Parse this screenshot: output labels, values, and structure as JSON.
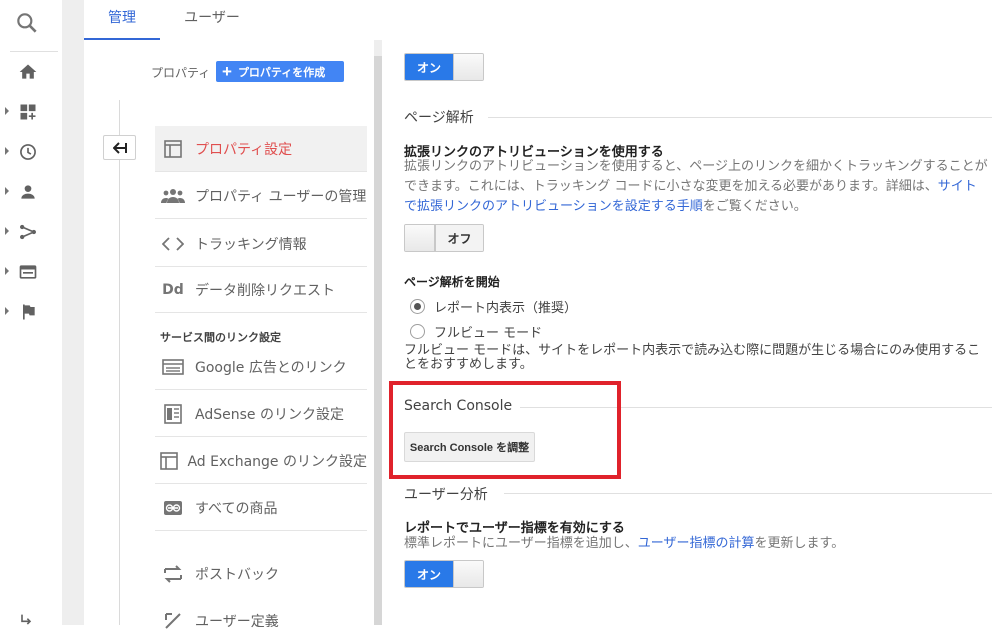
{
  "tabs": [
    {
      "label": "管理",
      "active": true
    },
    {
      "label": "ユーザー",
      "active": false
    }
  ],
  "leftnav": {
    "icons": [
      "search-icon",
      "home-icon",
      "customization-icon",
      "clock-icon",
      "person-icon",
      "acquisition-icon",
      "behavior-icon",
      "flag-icon"
    ]
  },
  "property_column": {
    "label": "プロパティ",
    "create_button": "プロパティを作成",
    "items": [
      {
        "label": "プロパティ設定",
        "icon": "property-settings-icon",
        "active": true
      },
      {
        "label": "プロパティ ユーザーの管理",
        "icon": "users-group-icon"
      },
      {
        "label": "トラッキング情報",
        "icon": "code-icon"
      },
      {
        "label": "データ削除リクエスト",
        "icon": "dd-icon"
      }
    ],
    "section_label": "サービス間のリンク設定",
    "link_items": [
      {
        "label": "Google 広告とのリンク",
        "icon": "ads-icon"
      },
      {
        "label": "AdSense のリンク設定",
        "icon": "adsense-icon"
      },
      {
        "label": "Ad Exchange のリンク設定",
        "icon": "adexchange-icon"
      },
      {
        "label": "すべての商品",
        "icon": "link-icon"
      }
    ],
    "extra_items": [
      {
        "label": "ポストバック",
        "icon": "postback-icon"
      },
      {
        "label": "ユーザー定義",
        "icon": "user-definition-icon"
      }
    ]
  },
  "main": {
    "top_toggle": {
      "on_label": "オン"
    },
    "page_analysis": {
      "heading": "ページ解析",
      "enhanced_title": "拡張リンクのアトリビューションを使用する",
      "enhanced_desc_line1": "拡張リンクのアトリビューションを使用すると、ページ上のリンクを細かくトラッキングすることが",
      "enhanced_desc_line2_pre": "できます。これには、トラッキング コードに小さな変更を加える必要があります。詳細は、",
      "enhanced_desc_line2_link": "サイト",
      "enhanced_desc_line3_link": "で拡張リンクのアトリビューションを設定する手順",
      "enhanced_desc_line3_post": "をご覧ください。",
      "enhanced_toggle_off": "オフ",
      "start_title": "ページ解析を開始",
      "radio_option_1": "レポート内表示（推奨）",
      "radio_option_2": "フルビュー モード",
      "note": "フルビュー モードは、サイトをレポート内表示で読み込む際に問題が生じる場合にのみ使用することをおすすめします。"
    },
    "search_console": {
      "heading": "Search Console",
      "button": "Search Console を調整"
    },
    "user_analysis": {
      "heading": "ユーザー分析",
      "title": "レポートでユーザー指標を有効にする",
      "desc_pre": "標準レポートにユーザー指標を追加し、",
      "desc_link": "ユーザー指標の計算",
      "desc_post": "を更新します。",
      "toggle_on": "オン"
    }
  },
  "colors": {
    "accent_blue": "#3367d6",
    "toggle_blue": "#2979e8",
    "active_item_red": "#e04f4f",
    "highlight_red": "#e0222b"
  }
}
